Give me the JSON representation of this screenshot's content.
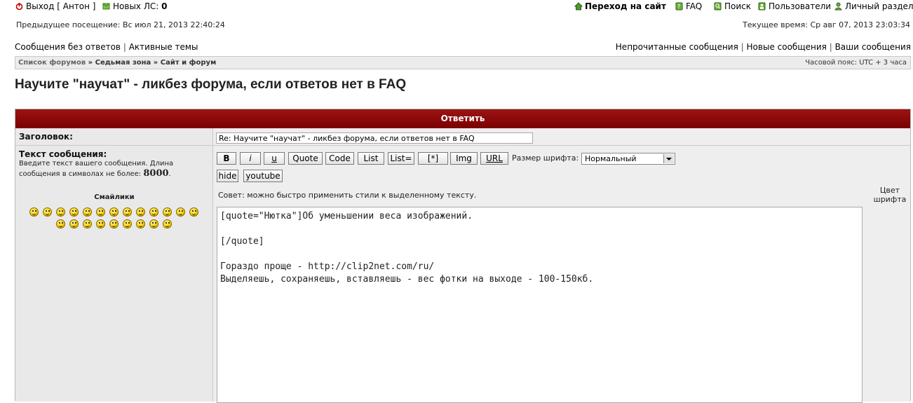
{
  "top": {
    "logout_label": "Выход [ Антон ]",
    "pm_label": "Новых ЛС:",
    "pm_count": "0",
    "goto_site": "Переход на сайт",
    "faq": "FAQ",
    "search": "Поиск",
    "users": "Пользователи",
    "personal": "Личный раздел"
  },
  "visits": {
    "previous": "Предыдущее посещение: Вс июл 21, 2013 22:40:24",
    "current": "Текущее время: Ср авг 07, 2013 23:03:34"
  },
  "nav": {
    "left": [
      "Сообщения без ответов",
      "Активные темы"
    ],
    "right": [
      "Непрочитанные сообщения",
      "Новые сообщения",
      "Ваши сообщения"
    ],
    "separator": "|"
  },
  "breadcrumb": {
    "items": [
      "Список форумов",
      "Седьмая зона",
      "Сайт и форум"
    ],
    "separator": "»",
    "timezone": "Часовой пояс: UTC + 3 часа"
  },
  "page_title": "Научите \"научат\" - ликбез форума, если ответов нет в FAQ",
  "reply": {
    "header": "Ответить",
    "subject_label": "Заголовок:",
    "subject_value": "Re: Научите \"научат\" - ликбез форума, если ответов нет в FAQ",
    "body_label": "Текст сообщения:",
    "body_hint": "Введите текст вашего сообщения. Длина сообщения в символах не более:",
    "body_max": "8000",
    "smilies_label": "Смайлики",
    "buttons": [
      "B",
      "i",
      "u",
      "Quote",
      "Code",
      "List",
      "List=",
      "[*]",
      "Img",
      "URL"
    ],
    "buttons2": [
      "hide",
      "youtube"
    ],
    "font_size_label": "Размер шрифта:",
    "font_size_value": "Нормальный",
    "tip": "Совет: можно быстро применить стили к выделенному тексту.",
    "color_label_1": "Цвет",
    "color_label_2": "шрифта",
    "text_lines": [
      "[quote=\"Нютка\"]Об уменьшении веса изображений.",
      "",
      "[/quote]",
      "",
      "Гораздо проще - http://clip2net.com/ru/",
      "Выделяешь, сохраняешь, вставляешь - вес фотки на выходе - 100-150кб."
    ]
  },
  "colors": {
    "header_bar": "#8b0b0b",
    "panel_bg": "#efefef",
    "accent_red": "#b30000"
  }
}
